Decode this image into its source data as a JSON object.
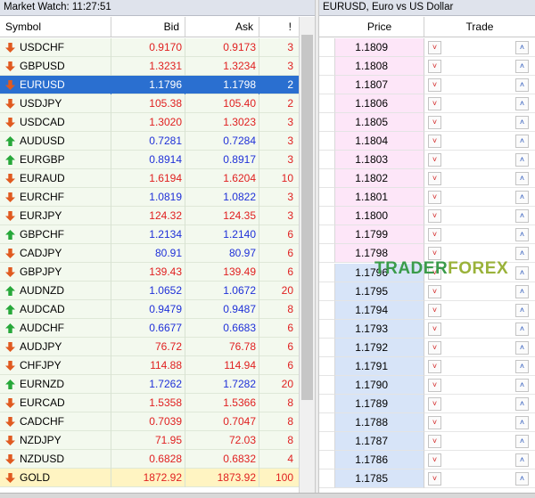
{
  "market_watch": {
    "title": "Market Watch: 11:27:51",
    "headers": {
      "symbol": "Symbol",
      "bid": "Bid",
      "ask": "Ask",
      "spread": "!"
    },
    "rows": [
      {
        "symbol": "USDCHF",
        "bid": "0.9170",
        "ask": "0.9173",
        "spread": "3",
        "direction": "down",
        "color": "#e02020",
        "selected": false
      },
      {
        "symbol": "GBPUSD",
        "bid": "1.3231",
        "ask": "1.3234",
        "spread": "3",
        "direction": "down",
        "color": "#e02020",
        "selected": false
      },
      {
        "symbol": "EURUSD",
        "bid": "1.1796",
        "ask": "1.1798",
        "spread": "2",
        "direction": "down",
        "color": "#ffffff",
        "selected": true
      },
      {
        "symbol": "USDJPY",
        "bid": "105.38",
        "ask": "105.40",
        "spread": "2",
        "direction": "down",
        "color": "#e02020",
        "selected": false
      },
      {
        "symbol": "USDCAD",
        "bid": "1.3020",
        "ask": "1.3023",
        "spread": "3",
        "direction": "down",
        "color": "#e02020",
        "selected": false
      },
      {
        "symbol": "AUDUSD",
        "bid": "0.7281",
        "ask": "0.7284",
        "spread": "3",
        "direction": "up",
        "color": "#1f30d8",
        "selected": false
      },
      {
        "symbol": "EURGBP",
        "bid": "0.8914",
        "ask": "0.8917",
        "spread": "3",
        "direction": "up",
        "color": "#1f30d8",
        "selected": false
      },
      {
        "symbol": "EURAUD",
        "bid": "1.6194",
        "ask": "1.6204",
        "spread": "10",
        "direction": "down",
        "color": "#e02020",
        "selected": false
      },
      {
        "symbol": "EURCHF",
        "bid": "1.0819",
        "ask": "1.0822",
        "spread": "3",
        "direction": "down",
        "color": "#1f30d8",
        "selected": false
      },
      {
        "symbol": "EURJPY",
        "bid": "124.32",
        "ask": "124.35",
        "spread": "3",
        "direction": "down",
        "color": "#e02020",
        "selected": false
      },
      {
        "symbol": "GBPCHF",
        "bid": "1.2134",
        "ask": "1.2140",
        "spread": "6",
        "direction": "up",
        "color": "#1f30d8",
        "selected": false
      },
      {
        "symbol": "CADJPY",
        "bid": "80.91",
        "ask": "80.97",
        "spread": "6",
        "direction": "down",
        "color": "#1f30d8",
        "selected": false
      },
      {
        "symbol": "GBPJPY",
        "bid": "139.43",
        "ask": "139.49",
        "spread": "6",
        "direction": "down",
        "color": "#e02020",
        "selected": false
      },
      {
        "symbol": "AUDNZD",
        "bid": "1.0652",
        "ask": "1.0672",
        "spread": "20",
        "direction": "up",
        "color": "#1f30d8",
        "selected": false
      },
      {
        "symbol": "AUDCAD",
        "bid": "0.9479",
        "ask": "0.9487",
        "spread": "8",
        "direction": "up",
        "color": "#1f30d8",
        "selected": false
      },
      {
        "symbol": "AUDCHF",
        "bid": "0.6677",
        "ask": "0.6683",
        "spread": "6",
        "direction": "up",
        "color": "#1f30d8",
        "selected": false
      },
      {
        "symbol": "AUDJPY",
        "bid": "76.72",
        "ask": "76.78",
        "spread": "6",
        "direction": "down",
        "color": "#e02020",
        "selected": false
      },
      {
        "symbol": "CHFJPY",
        "bid": "114.88",
        "ask": "114.94",
        "spread": "6",
        "direction": "down",
        "color": "#e02020",
        "selected": false
      },
      {
        "symbol": "EURNZD",
        "bid": "1.7262",
        "ask": "1.7282",
        "spread": "20",
        "direction": "up",
        "color": "#1f30d8",
        "selected": false
      },
      {
        "symbol": "EURCAD",
        "bid": "1.5358",
        "ask": "1.5366",
        "spread": "8",
        "direction": "down",
        "color": "#e02020",
        "selected": false
      },
      {
        "symbol": "CADCHF",
        "bid": "0.7039",
        "ask": "0.7047",
        "spread": "8",
        "direction": "down",
        "color": "#e02020",
        "selected": false
      },
      {
        "symbol": "NZDJPY",
        "bid": "71.95",
        "ask": "72.03",
        "spread": "8",
        "direction": "down",
        "color": "#e02020",
        "selected": false
      },
      {
        "symbol": "NZDUSD",
        "bid": "0.6828",
        "ask": "0.6832",
        "spread": "4",
        "direction": "down",
        "color": "#e02020",
        "selected": false
      },
      {
        "symbol": "GOLD",
        "bid": "1872.92",
        "ask": "1873.92",
        "spread": "100",
        "direction": "down",
        "color": "#e02020",
        "selected": false,
        "highlight": true
      }
    ]
  },
  "depth_of_market": {
    "title": "EURUSD, Euro vs US Dollar",
    "headers": {
      "price": "Price",
      "trade": "Trade"
    },
    "prices": [
      "1.1809",
      "1.1808",
      "1.1807",
      "1.1806",
      "1.1805",
      "1.1804",
      "1.1803",
      "1.1802",
      "1.1801",
      "1.1800",
      "1.1799",
      "1.1798",
      "1.1796",
      "1.1795",
      "1.1794",
      "1.1793",
      "1.1792",
      "1.1791",
      "1.1790",
      "1.1789",
      "1.1788",
      "1.1787",
      "1.1786",
      "1.1785"
    ],
    "ask_rows": 12,
    "sell_icon": "chevron-down-icon",
    "buy_icon": "chevron-up-icon"
  },
  "watermark": {
    "part1": "TRADER",
    "part2": "FOREX"
  },
  "colors": {
    "row_bg": "#f3f9ee",
    "selected_bg": "#2a6fd0",
    "gold_bg": "#fff4c2",
    "ask_bg": "#fde6f8",
    "bid_bg": "#d7e4f8",
    "up_arrow": "#27a83a",
    "down_arrow": "#e05a20",
    "watermark1": "#3a9b4a",
    "watermark2": "#9ab23a"
  }
}
